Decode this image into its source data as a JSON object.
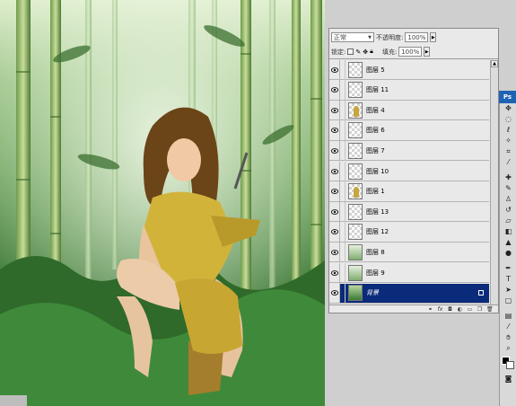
{
  "layers_panel": {
    "blend_mode": "正常",
    "opacity_label": "不透明度:",
    "opacity_value": "100%",
    "lock_label": "锁定:",
    "fill_label": "填充:",
    "fill_value": "100%",
    "layers": [
      {
        "name": "图层 5",
        "thumb": "empty"
      },
      {
        "name": "图层 11",
        "thumb": "empty"
      },
      {
        "name": "图层 4",
        "thumb": "figure"
      },
      {
        "name": "图层 6",
        "thumb": "empty"
      },
      {
        "name": "图层 7",
        "thumb": "empty"
      },
      {
        "name": "图层 10",
        "thumb": "empty"
      },
      {
        "name": "图层 1",
        "thumb": "figure"
      },
      {
        "name": "图层 13",
        "thumb": "empty"
      },
      {
        "name": "图层 12",
        "thumb": "empty"
      },
      {
        "name": "图层 8",
        "thumb": "image"
      },
      {
        "name": "图层 9",
        "thumb": "image"
      },
      {
        "name": "背景",
        "thumb": "background",
        "selected": true
      }
    ],
    "footer_icons": [
      "link-icon",
      "fx-icon",
      "mask-icon",
      "adjustment-icon",
      "group-icon",
      "new-layer-icon",
      "trash-icon"
    ]
  },
  "tools_panel": {
    "badge": "Ps",
    "tools": [
      "move-tool-icon",
      "marquee-tool-icon",
      "lasso-tool-icon",
      "magic-wand-tool-icon",
      "crop-tool-icon",
      "eyedropper-tool-icon",
      "healing-brush-tool-icon",
      "brush-tool-icon",
      "clone-stamp-tool-icon",
      "history-brush-tool-icon",
      "eraser-tool-icon",
      "gradient-tool-icon",
      "blur-tool-icon",
      "dodge-tool-icon",
      "pen-tool-icon",
      "type-tool-icon",
      "path-selection-tool-icon",
      "shape-tool-icon",
      "notes-tool-icon",
      "eyedropper2-tool-icon",
      "hand-tool-icon",
      "zoom-tool-icon"
    ],
    "foreground_color": "#000000",
    "background_color": "#ffffff"
  },
  "colors": {
    "selected_layer": "#0a2a7a",
    "panel_bg": "#e9e9e9",
    "ps_blue": "#1f63b4"
  }
}
